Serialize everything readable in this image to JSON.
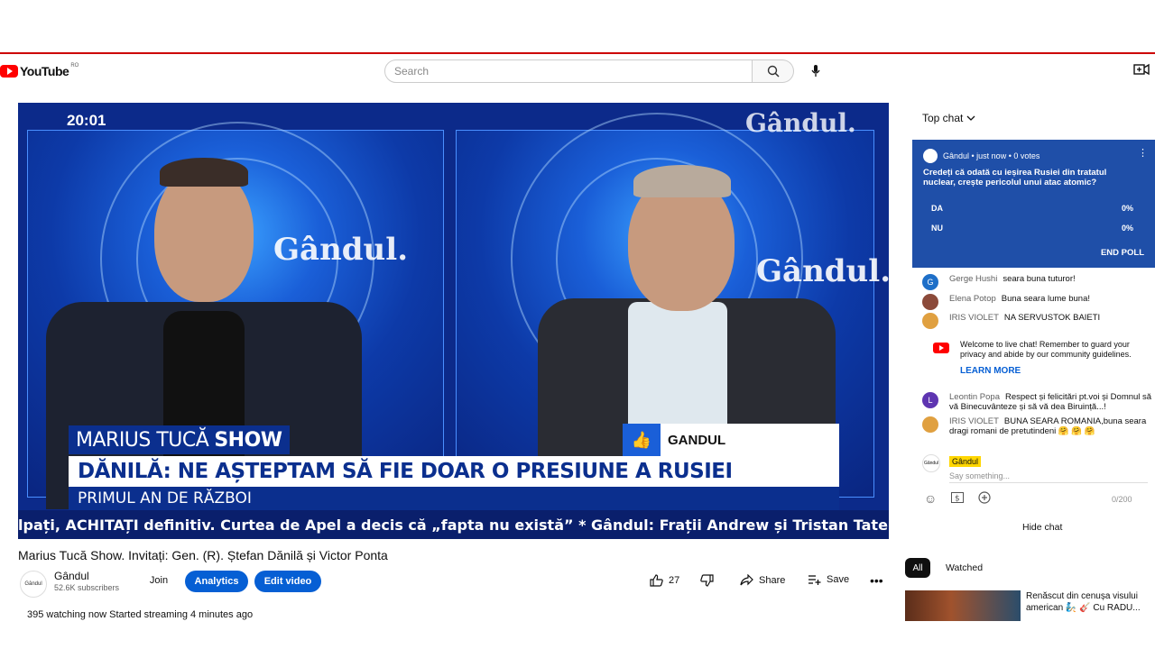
{
  "header": {
    "logo_text": "YouTube",
    "country_code": "RO",
    "search_placeholder": "Search"
  },
  "video": {
    "clock": "20:01",
    "brand_watermark": "Gândul.",
    "show_label_1": "MARIUS TUCĂ",
    "show_label_2": "SHOW",
    "like_tag": "GANDUL",
    "headline": "DĂNILĂ: NE AȘTEPTAM SĂ FIE DOAR O PRESIUNE A RUSIEI",
    "subline": "PRIMUL AN DE RĂZBOI",
    "ticker": "lpați, ACHITAȚI definitiv. Curtea de Apel a decis că „fapta nu există” * Gândul: Frații Andrew și Tristan Tate află AZ"
  },
  "title": "Marius Tucă Show. Invitați: Gen. (R). Ștefan Dănilă și Victor Ponta",
  "channel": {
    "avatar_text": "Gândul",
    "name": "Gândul",
    "subscribers": "52.6K subscribers",
    "join": "Join",
    "analytics": "Analytics",
    "edit_video": "Edit video"
  },
  "actions": {
    "likes": "27",
    "share": "Share",
    "save": "Save"
  },
  "stats": "395 watching now  Started streaming 4 minutes ago",
  "chat": {
    "mode": "Top chat",
    "poll": {
      "author_line": "Gândul • just now • 0 votes",
      "question": "Credeți că odată cu ieșirea Rusiei din tratatul nuclear, crește pericolul unui atac atomic?",
      "options": [
        {
          "label": "DA",
          "pct": "0%"
        },
        {
          "label": "NU",
          "pct": "0%"
        }
      ],
      "end_label": "END POLL"
    },
    "messages": [
      {
        "initial": "G",
        "color": "#1e6fc8",
        "author": "Gerge Hushi",
        "text": "seara buna tuturor!"
      },
      {
        "initial": "",
        "color": "#8b4a3a",
        "author": "Elena Potop",
        "text": "Buna seara lume buna!"
      },
      {
        "initial": "",
        "color": "#e0a040",
        "author": "IRIS VIOLET",
        "text": "NA SERVUSTOK BAIETI"
      }
    ],
    "welcome_text": "Welcome to live chat! Remember to guard your privacy and abide by our community guidelines.",
    "learn_more": "LEARN MORE",
    "messages2": [
      {
        "initial": "L",
        "color": "#5e35b1",
        "author": "Leontin Popa",
        "text": "Respect și felicitări pt.voi și Domnul să vă Binecuvânteze și să vă dea Biruință...!"
      },
      {
        "initial": "",
        "color": "#e0a040",
        "author": "IRIS VIOLET",
        "text": "BUNA SEARA ROMANIA,buna seara dragi romani de pretutindeni 🤗 🤗 🤗"
      }
    ],
    "input_author": "Gândul",
    "input_avatar_text": "Gândul",
    "input_placeholder": "Say something...",
    "char_count": "0/200",
    "hide_chat": "Hide chat"
  },
  "sidebar": {
    "chip_all": "All",
    "chip_watched": "Watched",
    "rec_title": "Renăscut din cenușa visului american 🧞 🎸 Cu RADU..."
  },
  "colors": {
    "brand_red": "#ff0000",
    "accent_blue": "#065fd4",
    "poll_blue": "#1f4fa8",
    "tv_blue": "#0b2f8e"
  }
}
